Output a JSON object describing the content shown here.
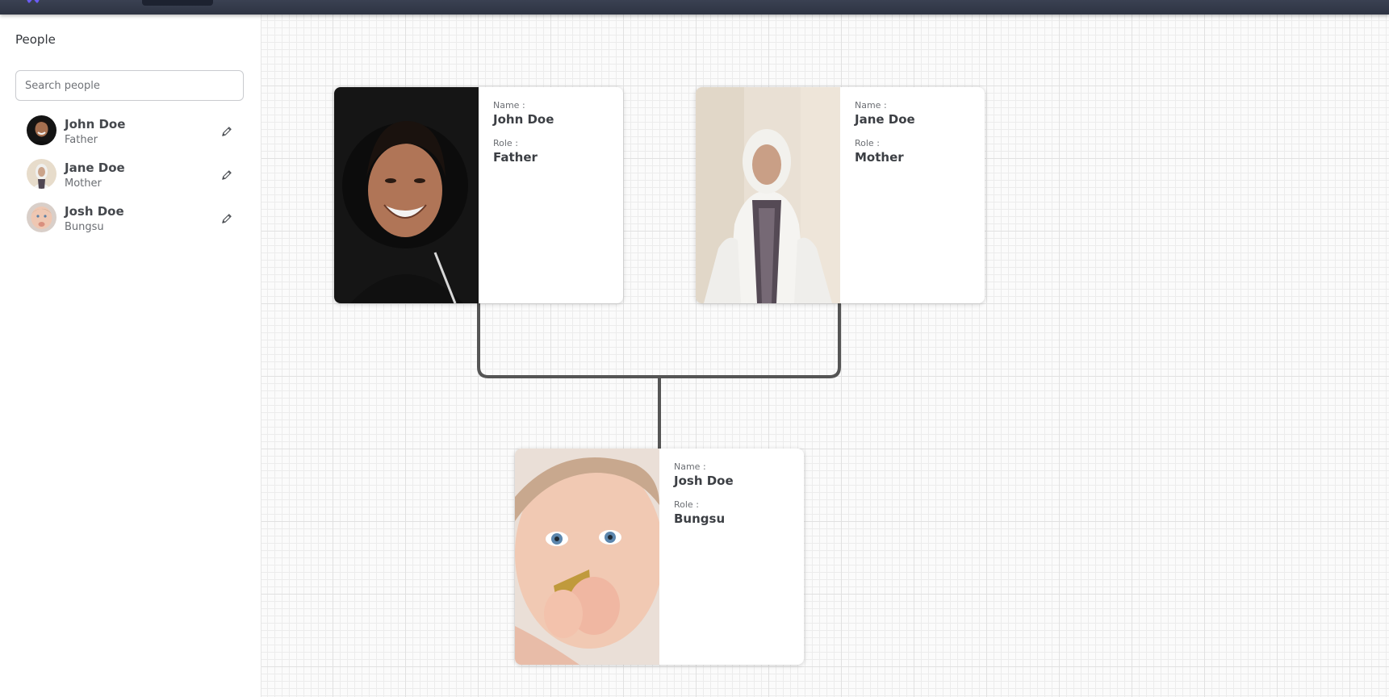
{
  "sidebar": {
    "title": "People",
    "search": {
      "placeholder": "Search people",
      "value": ""
    },
    "people": [
      {
        "name": "John Doe",
        "role": "Father"
      },
      {
        "name": "Jane Doe",
        "role": "Mother"
      },
      {
        "name": "Josh Doe",
        "role": "Bungsu"
      }
    ]
  },
  "tree": {
    "name_label": "Name :",
    "role_label": "Role :",
    "cards": [
      {
        "name": "John Doe",
        "role": "Father"
      },
      {
        "name": "Jane Doe",
        "role": "Mother"
      },
      {
        "name": "Josh Doe",
        "role": "Bungsu"
      }
    ]
  },
  "icons": {
    "edit": "pencil-icon",
    "logo": "app-logo-icon"
  },
  "colors": {
    "topbar": "#2e3443",
    "connector": "#555555",
    "logo_accent": "#6b5cf6"
  }
}
